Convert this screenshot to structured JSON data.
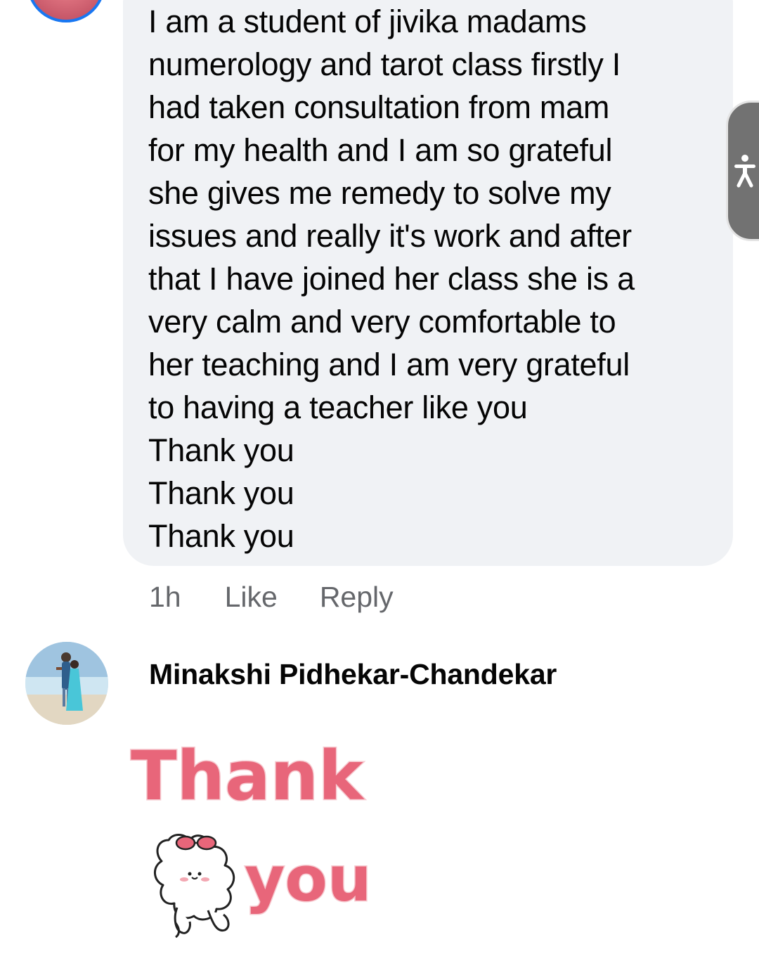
{
  "comment": {
    "text": "I am a student of jivika madams\nnumerology and tarot class firstly I\nhad taken consultation from mam\nfor my health and I am so grateful\nshe gives me remedy to solve my\nissues and really it's work and after\nthat I have joined her class she is a\nvery calm and very comfortable to\nher teaching and I am very grateful\nto having a teacher like you\nThank you\nThank you\nThank you",
    "time": "1h",
    "like_label": "Like",
    "reply_label": "Reply"
  },
  "reply": {
    "author": "Minakshi Pidhekar-Chandekar",
    "sticker": {
      "line1": "Thank",
      "line2": "you"
    }
  },
  "colors": {
    "bubble_bg": "#f0f2f5",
    "meta_text": "#65676b",
    "avatar_ring": "#1877f2",
    "sticker_pink": "#e8667a"
  },
  "icons": {
    "accessibility": "accessibility-person-icon"
  }
}
